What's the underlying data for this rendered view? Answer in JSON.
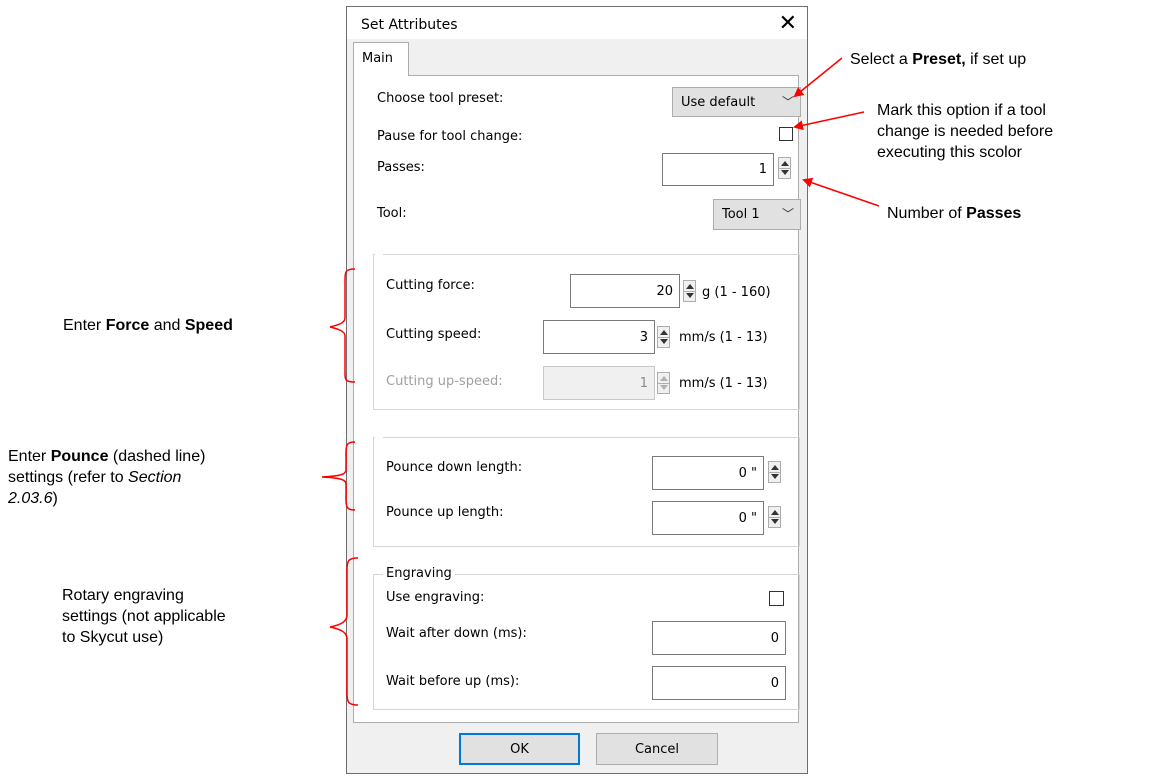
{
  "dialog": {
    "title": "Set Attributes",
    "close_glyph": "✕",
    "tab_main": "Main",
    "choose_tool_preset_label": "Choose tool preset:",
    "preset_value": "Use default",
    "pause_label": "Pause for tool change:",
    "passes_label": "Passes:",
    "passes_value": "1",
    "tool_label": "Tool:",
    "tool_value": "Tool 1",
    "cutting_force_label": "Cutting force:",
    "cutting_force_value": "20",
    "cutting_force_unit": "g (1 - 160)",
    "cutting_speed_label": "Cutting speed:",
    "cutting_speed_value": "3",
    "cutting_speed_unit": "mm/s (1 - 13)",
    "cutting_upspeed_label": "Cutting up-speed:",
    "cutting_upspeed_value": "1",
    "cutting_upspeed_unit": "mm/s (1 - 13)",
    "pounce_down_label": "Pounce down length:",
    "pounce_down_value": "0 \"",
    "pounce_up_label": "Pounce up length:",
    "pounce_up_value": "0 \"",
    "engraving_group": "Engraving",
    "use_engraving_label": "Use engraving:",
    "wait_after_down_label": "Wait after down (ms):",
    "wait_after_down_value": "0",
    "wait_before_up_label": "Wait before up (ms):",
    "wait_before_up_value": "0",
    "ok_label": "OK",
    "cancel_label": "Cancel"
  },
  "annotations": {
    "preset": {
      "pre": "Select a ",
      "bold": "Preset,",
      "post": " if set up"
    },
    "pause_line1": "Mark this option if a tool",
    "pause_line2": "change is needed before",
    "pause_line3": "executing this scolor",
    "passes": {
      "pre": "Number of ",
      "bold": "Passes"
    },
    "force": {
      "pre": "Enter ",
      "bold1": "Force",
      "mid": " and ",
      "bold2": "Speed"
    },
    "pounce": {
      "pre": "Enter ",
      "bold": "Pounce",
      "post": " (dashed line)",
      "line2": "settings (refer to ",
      "line2_italic": "Section",
      "line3_italic": "2.03.6",
      "line3_post": ")"
    },
    "engraving_line1": "Rotary engraving",
    "engraving_line2": "settings (not applicable",
    "engraving_line3": "to Skycut use)"
  },
  "colors": {
    "arrow": "#ff0000",
    "bracket": "#ff0000",
    "ok_focus": "#0078d7"
  }
}
